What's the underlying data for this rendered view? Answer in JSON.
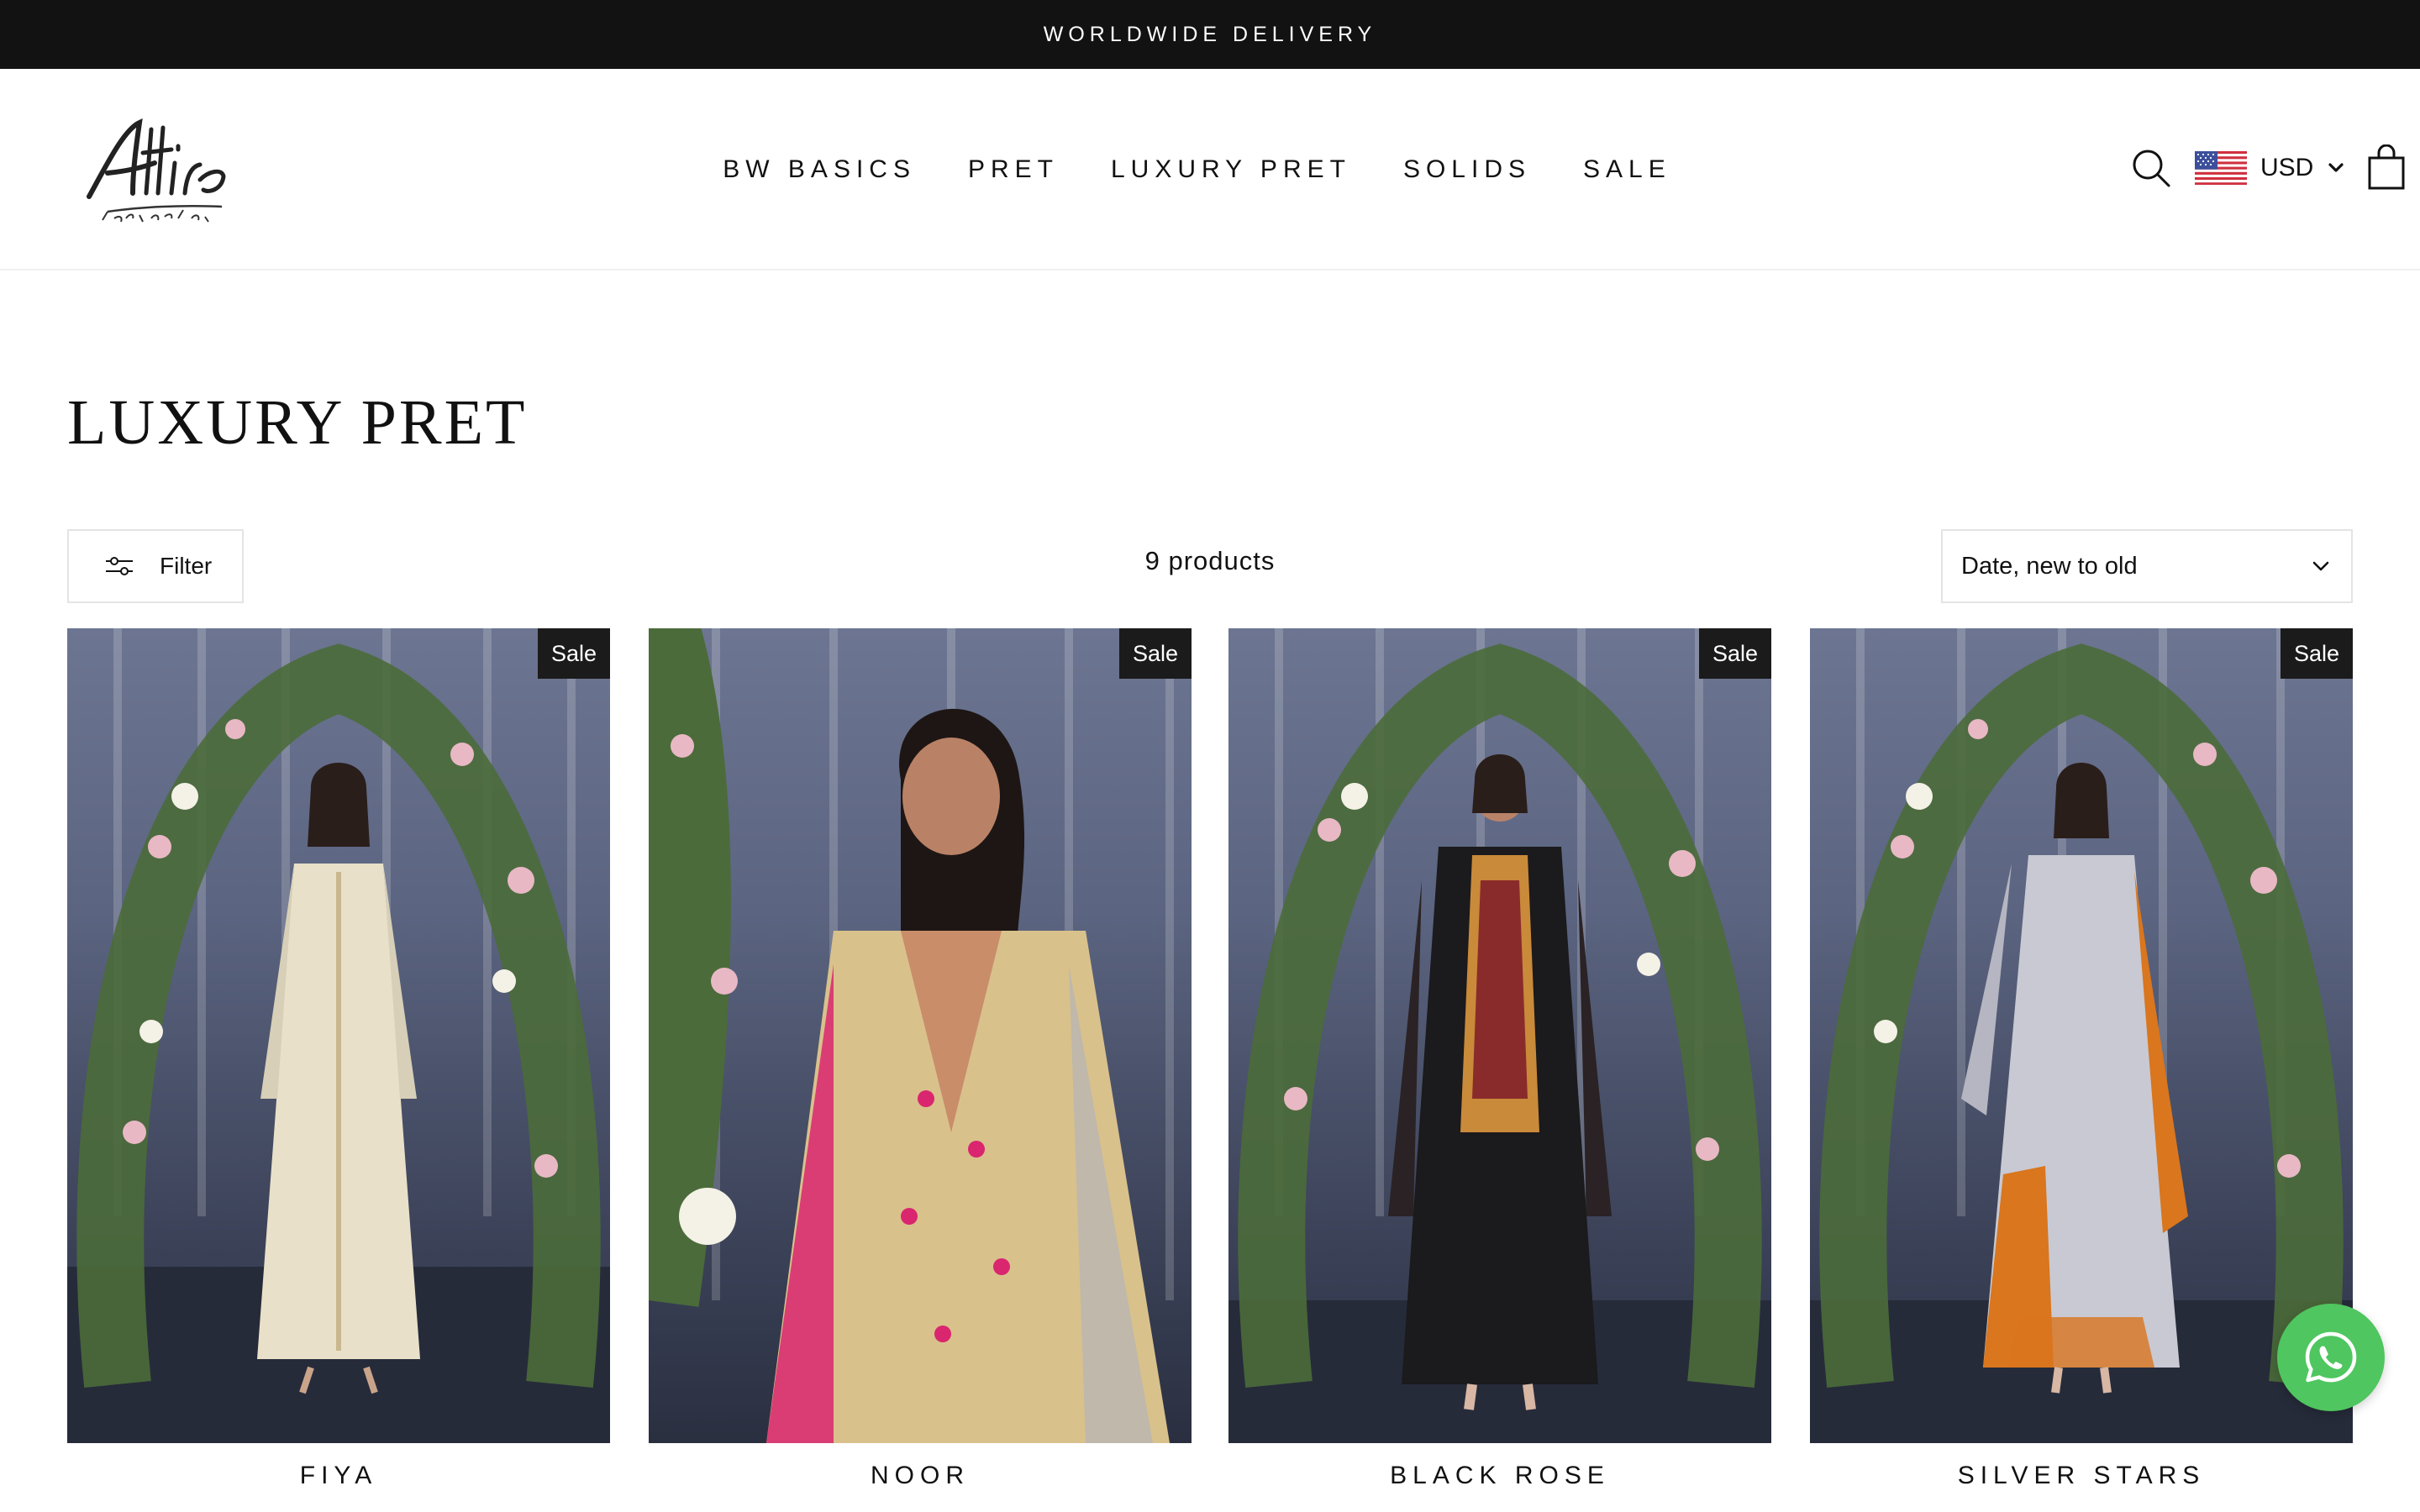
{
  "announcement": "WORLDWIDE DELIVERY",
  "logo": {
    "name": "Attire",
    "tagline": "By Bushra Wahid"
  },
  "nav": [
    "BW BASICS",
    "PRET",
    "LUXURY PRET",
    "SOLIDS",
    "SALE"
  ],
  "header": {
    "search_icon": "search-icon",
    "currency": "USD",
    "cart_icon": "cart-icon"
  },
  "collection": {
    "title": "LUXURY PRET",
    "filter_label": "Filter",
    "product_count": "9 products",
    "sort_value": "Date, new to old"
  },
  "products": [
    {
      "title": "FIYA",
      "badge": "Sale",
      "dress_color": "#e9e0c9",
      "accent": "#d7cfb7"
    },
    {
      "title": "NOOR",
      "badge": "Sale",
      "dress_color": "#d9c18c",
      "accent": "#d9266f"
    },
    {
      "title": "BLACK ROSE",
      "badge": "Sale",
      "dress_color": "#1b1a1c",
      "accent": "#c98a3a"
    },
    {
      "title": "SILVER STARS",
      "badge": "Sale",
      "dress_color": "#c8c9d3",
      "accent": "#d9761e"
    }
  ],
  "colors": {
    "announcement_bg": "#121212",
    "badge_bg": "#1b1b1b",
    "whatsapp": "#4fc65f"
  }
}
